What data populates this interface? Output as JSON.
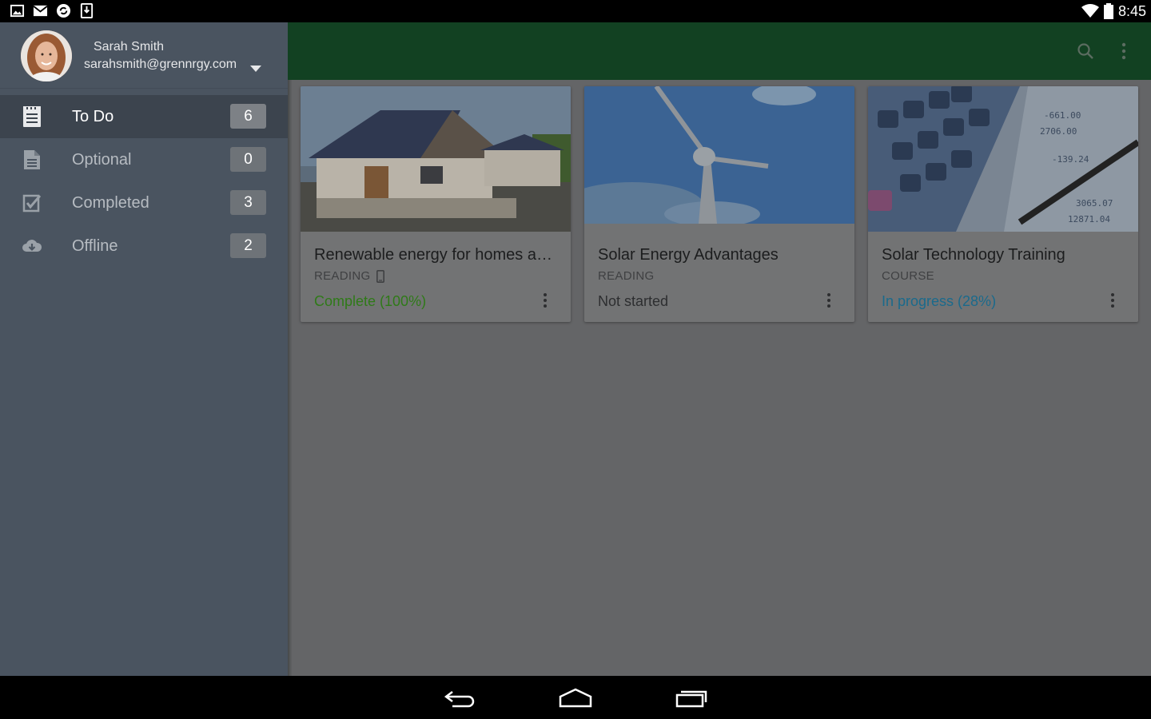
{
  "status_bar": {
    "time": "8:45",
    "left_icons": [
      "gallery-icon",
      "gmail-icon",
      "sync-icon",
      "download-icon"
    ],
    "right_icons": [
      "wifi-icon",
      "battery-icon"
    ]
  },
  "app_bar": {
    "color": "#124122",
    "actions": [
      "search-icon",
      "overflow-menu-icon"
    ]
  },
  "drawer": {
    "user": {
      "name": "Sarah Smith",
      "email": "sarahsmith@grennrgy.com"
    },
    "items": [
      {
        "label": "To Do",
        "count": "6",
        "icon": "todo-list-icon",
        "active": true
      },
      {
        "label": "Optional",
        "count": "0",
        "icon": "document-icon",
        "active": false
      },
      {
        "label": "Completed",
        "count": "3",
        "icon": "checkbox-icon",
        "active": false
      },
      {
        "label": "Offline",
        "count": "2",
        "icon": "cloud-download-icon",
        "active": false
      }
    ]
  },
  "cards": [
    {
      "title": "Renewable energy for homes an...",
      "type": "READING",
      "status": "Complete (100%)",
      "status_color": "#2f7a18",
      "device_icon": true
    },
    {
      "title": "Solar Energy Advantages",
      "type": "READING",
      "status": "Not started",
      "status_color": "#2d2e30",
      "device_icon": false
    },
    {
      "title": "Solar Technology Training",
      "type": "COURSE",
      "status": "In progress (28%)",
      "status_color": "#1a6a8c",
      "device_icon": false
    }
  ],
  "nav_bar": {
    "buttons": [
      "back-icon",
      "home-icon",
      "recents-icon"
    ]
  }
}
